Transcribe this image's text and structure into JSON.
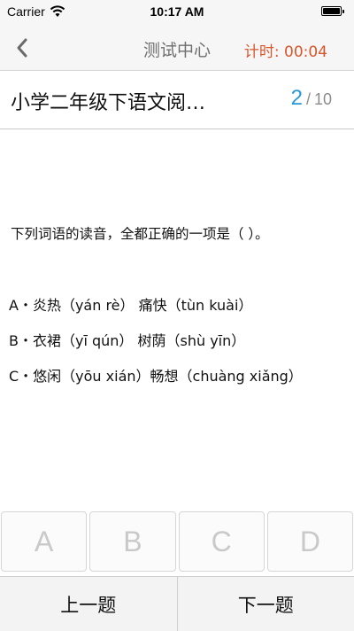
{
  "status_bar": {
    "carrier": "Carrier",
    "time": "10:17 AM",
    "battery_level": 1.0
  },
  "nav": {
    "title": "测试中心",
    "timer": "计时: 00:04",
    "back_icon": "chevron-left-icon"
  },
  "paper": {
    "title": "小学二年级下语文阅…",
    "current": "2",
    "separator": "/",
    "total": "10"
  },
  "question": {
    "text": "下列词语的读音，全都正确的一项是（    ）。",
    "options": [
      "A・炎热（yán rè） 痛快（tùn kuài）",
      "B・衣裙（yī qún） 树荫（shù yīn）",
      "C・悠闲（yōu xián）畅想（chuàng xiǎng）"
    ]
  },
  "answers": [
    "A",
    "B",
    "C",
    "D"
  ],
  "bottom": {
    "prev_label": "上一题",
    "next_label": "下一题"
  },
  "colors": {
    "timer": "#d8562b",
    "progress_current": "#2a97d8"
  }
}
